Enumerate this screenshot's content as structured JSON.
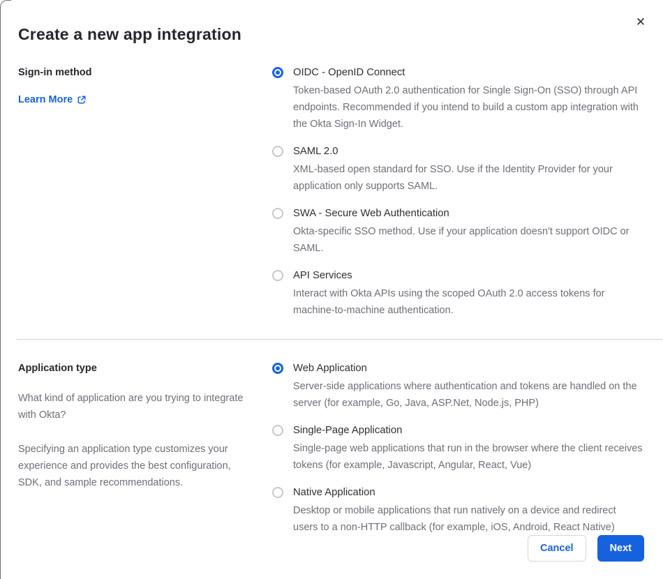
{
  "modal": {
    "title": "Create a new app integration",
    "close_glyph": "✕"
  },
  "signin_section": {
    "label": "Sign-in method",
    "learn_more_label": "Learn More",
    "options": [
      {
        "label": "OIDC - OpenID Connect",
        "description": "Token-based OAuth 2.0 authentication for Single Sign-On (SSO) through API endpoints. Recommended if you intend to build a custom app integration with the Okta Sign-In Widget.",
        "selected": true
      },
      {
        "label": "SAML 2.0",
        "description": "XML-based open standard for SSO. Use if the Identity Provider for your application only supports SAML.",
        "selected": false
      },
      {
        "label": "SWA - Secure Web Authentication",
        "description": "Okta-specific SSO method. Use if your application doesn't support OIDC or SAML.",
        "selected": false
      },
      {
        "label": "API Services",
        "description": "Interact with Okta APIs using the scoped OAuth 2.0 access tokens for machine-to-machine authentication.",
        "selected": false
      }
    ]
  },
  "apptype_section": {
    "label": "Application type",
    "paragraph_1": "What kind of application are you trying to integrate with Okta?",
    "paragraph_2": "Specifying an application type customizes your experience and provides the best configuration, SDK, and sample recommendations.",
    "options": [
      {
        "label": "Web Application",
        "description": "Server-side applications where authentication and tokens are handled on the server (for example, Go, Java, ASP.Net, Node.js, PHP)",
        "selected": true
      },
      {
        "label": "Single-Page Application",
        "description": "Single-page web applications that run in the browser where the client receives tokens (for example, Javascript, Angular, React, Vue)",
        "selected": false
      },
      {
        "label": "Native Application",
        "description": "Desktop or mobile applications that run natively on a device and redirect users to a non-HTTP callback (for example, iOS, Android, React Native)",
        "selected": false
      }
    ]
  },
  "footer": {
    "cancel_label": "Cancel",
    "next_label": "Next"
  },
  "colors": {
    "primary_blue": "#1662dd",
    "heading_text": "#26272d",
    "body_gray": "#6e6e78",
    "divider": "#d4d4d9",
    "radio_unselected_border": "#c7c7cd"
  }
}
